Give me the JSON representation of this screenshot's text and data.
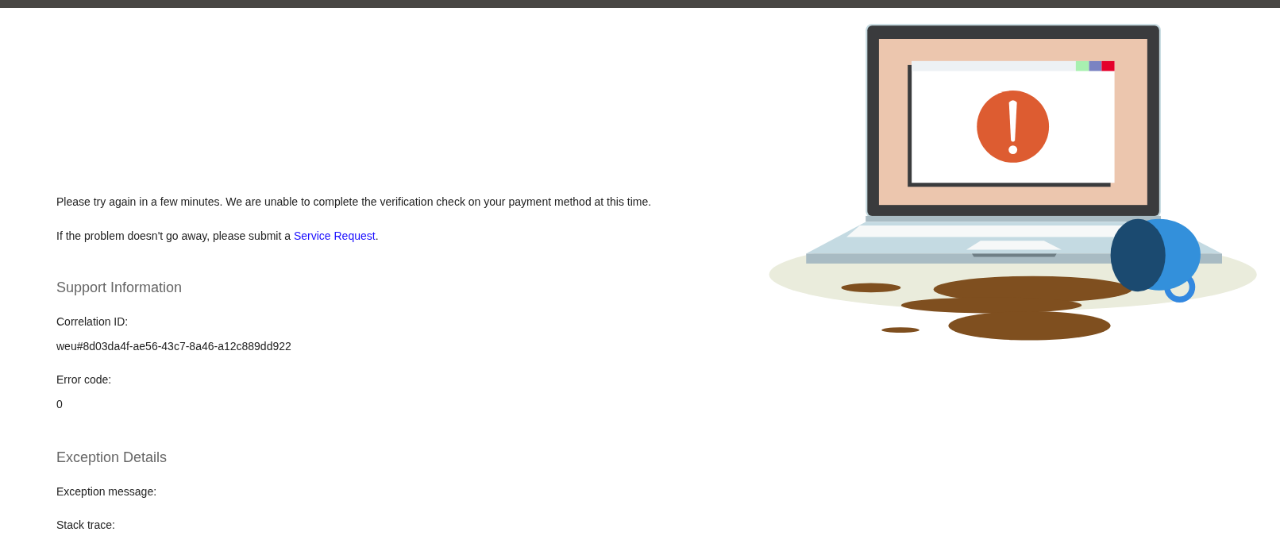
{
  "message": {
    "text": "Please try again in a few minutes. We are unable to complete the verification check on your payment method at this time."
  },
  "help": {
    "text": "If the problem doesn't go away, please submit a",
    "link": "Service Request",
    "after": "."
  },
  "sections": [
    {
      "title": "Support Information",
      "fields": [
        {
          "label": "Correlation ID:",
          "value": "weu#8d03da4f-ae56-43c7-8a46-a12c889dd922"
        },
        {
          "label": "Error code:",
          "value": "0"
        }
      ]
    },
    {
      "title": "Exception Details",
      "fields": [
        {
          "label": "Exception message:"
        },
        {
          "label": "Stack trace:"
        }
      ]
    }
  ]
}
